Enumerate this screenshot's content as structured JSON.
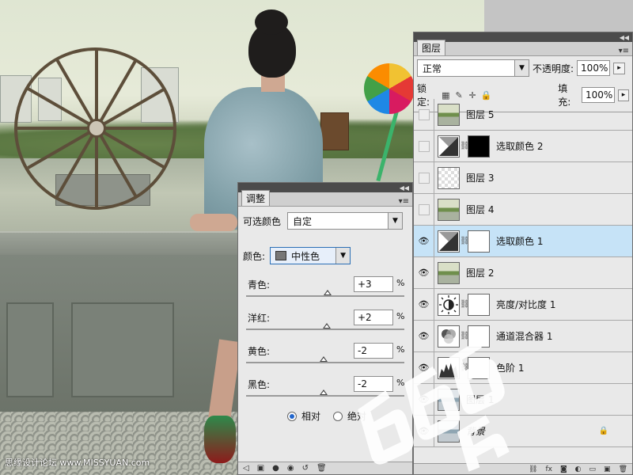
{
  "canvas": {
    "watermark_text": "思缘设计论坛 www.MISSYUAN.com",
    "logo_text": "6666"
  },
  "layers_panel": {
    "tab_label": "图层",
    "blend_mode": "正常",
    "opacity_label": "不透明度:",
    "opacity_value": "100%",
    "lock_label": "锁定:",
    "fill_label": "填充:",
    "fill_value": "100%",
    "layers": [
      {
        "name": "图层 5",
        "visible": false,
        "thumb": "photo",
        "mask": null,
        "selected": false
      },
      {
        "name": "选取颜色 2",
        "visible": false,
        "thumb": "adjustment-selective-color",
        "mask": "black",
        "selected": false
      },
      {
        "name": "图层 3",
        "visible": false,
        "thumb": "checker",
        "mask": null,
        "selected": false
      },
      {
        "name": "图层 4",
        "visible": false,
        "thumb": "photo",
        "mask": null,
        "selected": false
      },
      {
        "name": "选取颜色 1",
        "visible": true,
        "thumb": "adjustment-selective-color",
        "mask": "white",
        "selected": true
      },
      {
        "name": "图层 2",
        "visible": true,
        "thumb": "photo",
        "mask": null,
        "selected": false
      },
      {
        "name": "亮度/对比度 1",
        "visible": true,
        "thumb": "adjustment-brightness",
        "mask": "white",
        "selected": false
      },
      {
        "name": "通道混合器 1",
        "visible": true,
        "thumb": "adjustment-channel-mixer",
        "mask": "white",
        "selected": false
      },
      {
        "name": "色阶 1",
        "visible": true,
        "thumb": "adjustment-levels",
        "mask": "white",
        "selected": false
      },
      {
        "name": "图层 1",
        "visible": true,
        "thumb": "photo-cold",
        "mask": null,
        "selected": false
      },
      {
        "name": "背景",
        "visible": true,
        "thumb": "photo-cold",
        "mask": null,
        "selected": false,
        "locked": true
      }
    ]
  },
  "adjust_panel": {
    "tab_label": "调整",
    "type_label": "可选颜色",
    "preset_value": "自定",
    "color_label": "颜色:",
    "color_value": "中性色",
    "sliders": [
      {
        "label": "青色:",
        "value": "+3",
        "pct": "%",
        "position": 0.515
      },
      {
        "label": "洋红:",
        "value": "+2",
        "pct": "%",
        "position": 0.51
      },
      {
        "label": "黄色:",
        "value": "-2",
        "pct": "%",
        "position": 0.49
      },
      {
        "label": "黑色:",
        "value": "-2",
        "pct": "%",
        "position": 0.49
      }
    ],
    "method_relative": "相对",
    "method_absolute": "绝对",
    "method_selected": "relative"
  }
}
